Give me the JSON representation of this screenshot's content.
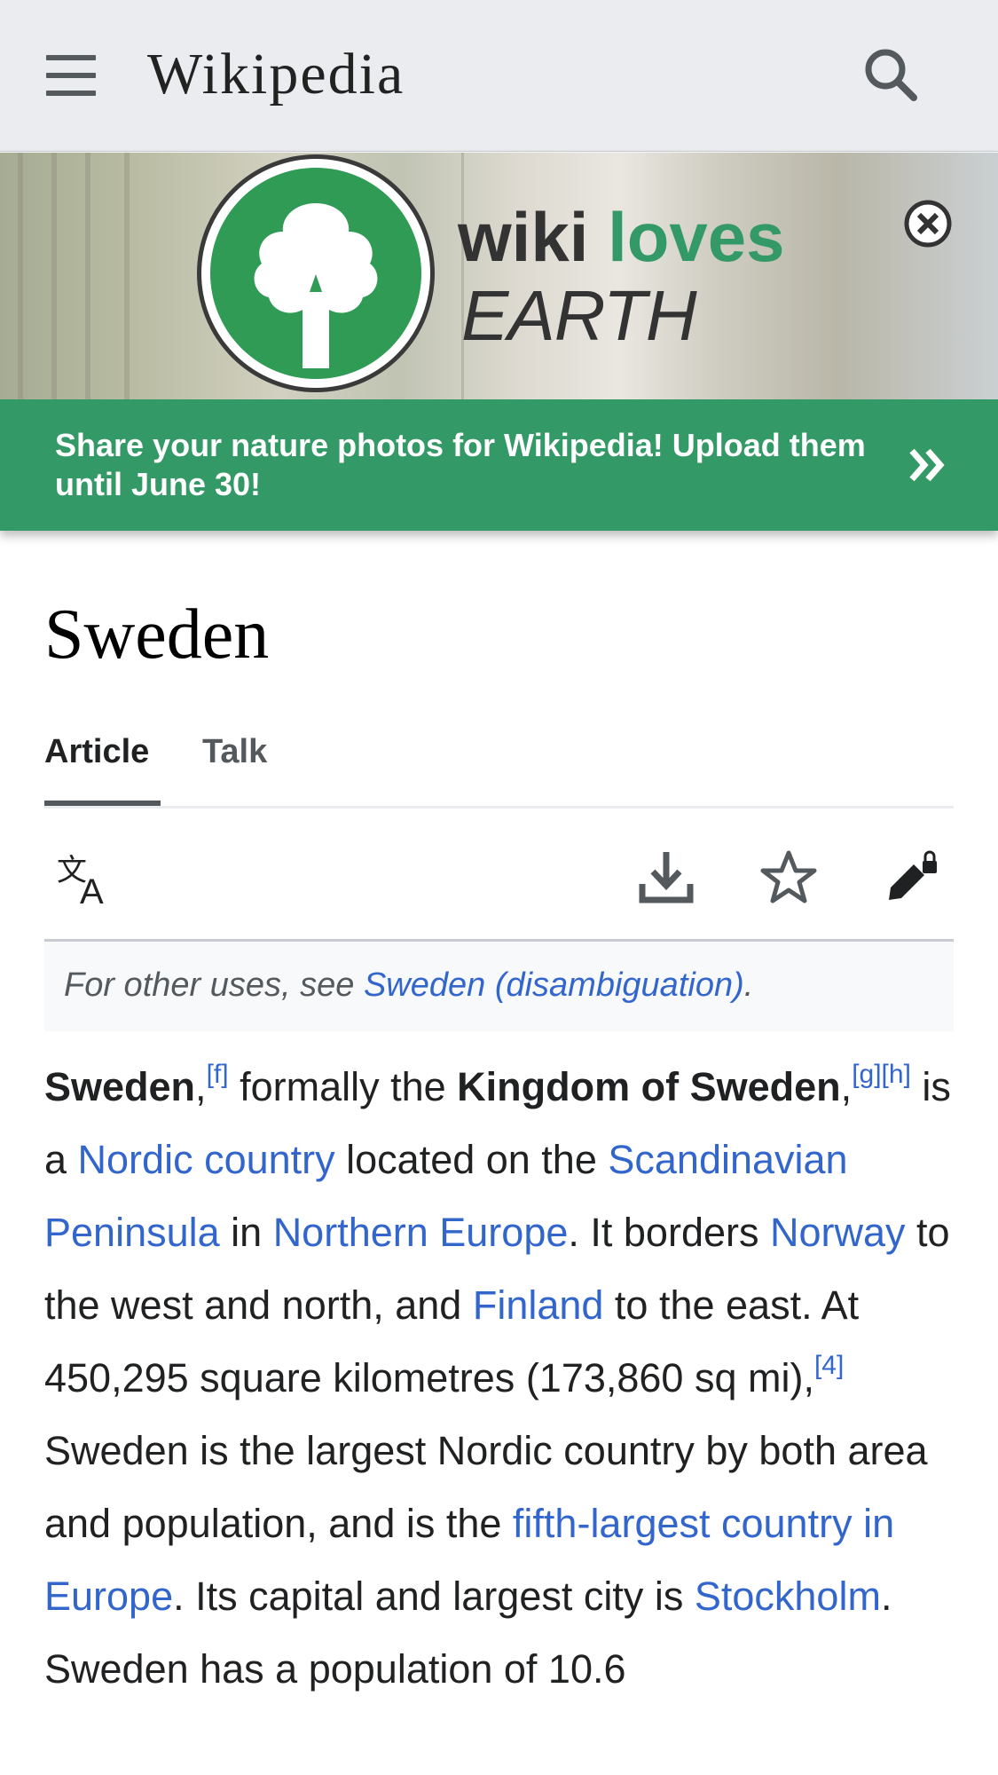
{
  "header": {
    "wordmark": "Wikipedia",
    "menu_icon": "hamburger-menu-icon",
    "search_icon": "search-icon"
  },
  "banner": {
    "logo_word1": "wiki",
    "logo_word2": "loves",
    "logo_word3": "EARTH",
    "message": "Share your nature photos for Wikipedia! Upload them until June 30!",
    "close_icon": "close-circle-icon",
    "next_icon": "double-chevron-right-icon",
    "accent_color": "#339966"
  },
  "page": {
    "title": "Sweden",
    "tabs": [
      {
        "label": "Article"
      },
      {
        "label": "Talk"
      }
    ]
  },
  "actions": {
    "language_icon": "language-icon",
    "download_icon": "download-icon",
    "watch_icon": "star-icon",
    "edit_icon": "edit-locked-icon"
  },
  "hatnote": {
    "prefix": "For other uses, see ",
    "link": "Sweden (disambiguation)",
    "suffix": "."
  },
  "article": {
    "t1": "Sweden",
    "t2": ",",
    "ref_f": "[f]",
    "t3": " formally the ",
    "t4": "Kingdom of Sweden",
    "t5": ",",
    "ref_g": "[g]",
    "ref_h": "[h]",
    "t6": " is a ",
    "l_nordic": "Nordic country",
    "t7": " located on the ",
    "l_peninsula": "Scandinavian Peninsula",
    "t8": " in ",
    "l_northern": "Northern Europe",
    "t9": ". It borders ",
    "l_norway": "Norway",
    "t10": " to the west and north, and ",
    "l_finland": "Finland",
    "t11": " to the east. At 450,295 square kilometres (173,860 sq mi),",
    "ref_4": "[4]",
    "t12": " Sweden is the largest Nordic country by both area and population, and is the ",
    "l_fifth": "fifth-largest country in Europe",
    "t13": ". Its capital and largest city is ",
    "l_stockholm": "Stockholm",
    "t14": ". Sweden has a population of 10.6"
  }
}
